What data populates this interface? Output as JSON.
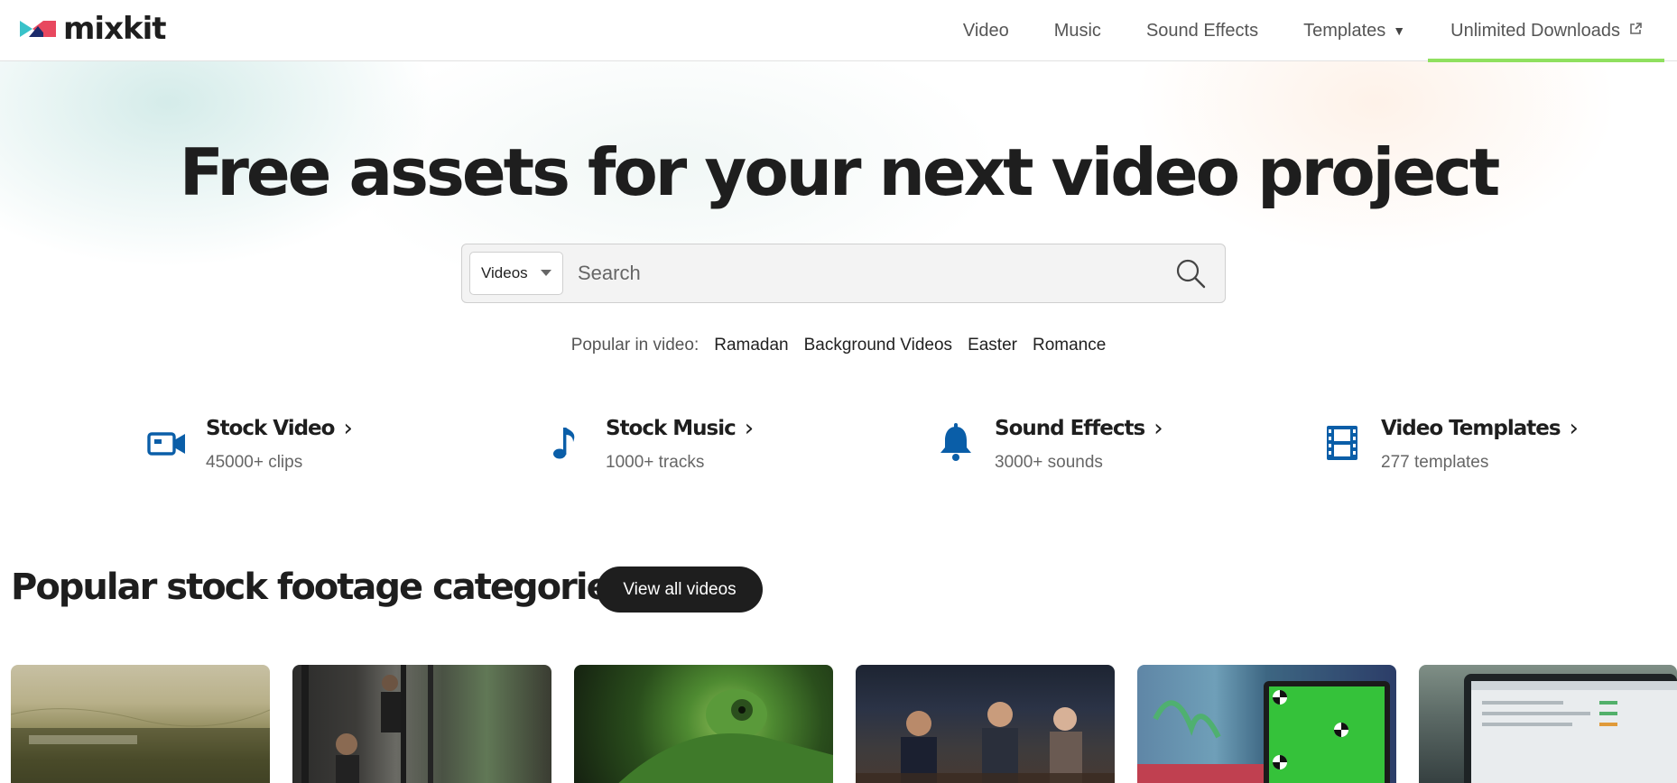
{
  "header": {
    "logo_text": "mixkit",
    "nav": [
      {
        "label": "Video"
      },
      {
        "label": "Music"
      },
      {
        "label": "Sound Effects"
      },
      {
        "label": "Templates"
      },
      {
        "label": "Unlimited Downloads"
      }
    ]
  },
  "hero": {
    "title": "Free assets for your next video project",
    "search": {
      "category": "Videos",
      "placeholder": "Search",
      "value": ""
    },
    "popular": {
      "label": "Popular in video:",
      "tags": [
        "Ramadan",
        "Background Videos",
        "Easter",
        "Romance"
      ]
    }
  },
  "categories": [
    {
      "title": "Stock Video",
      "sub": "45000+ clips",
      "icon": "video-camera-icon"
    },
    {
      "title": "Stock Music",
      "sub": "1000+ tracks",
      "icon": "music-note-icon"
    },
    {
      "title": "Sound Effects",
      "sub": "3000+ sounds",
      "icon": "bell-icon"
    },
    {
      "title": "Video Templates",
      "sub": "277 templates",
      "icon": "film-strip-icon"
    }
  ],
  "section": {
    "title": "Popular stock footage categories",
    "view_all_label": "View all videos"
  },
  "colors": {
    "accent_icon": "#0a5ea8",
    "active_underline": "#8fe05f",
    "dark_button": "#1e1e1e"
  }
}
